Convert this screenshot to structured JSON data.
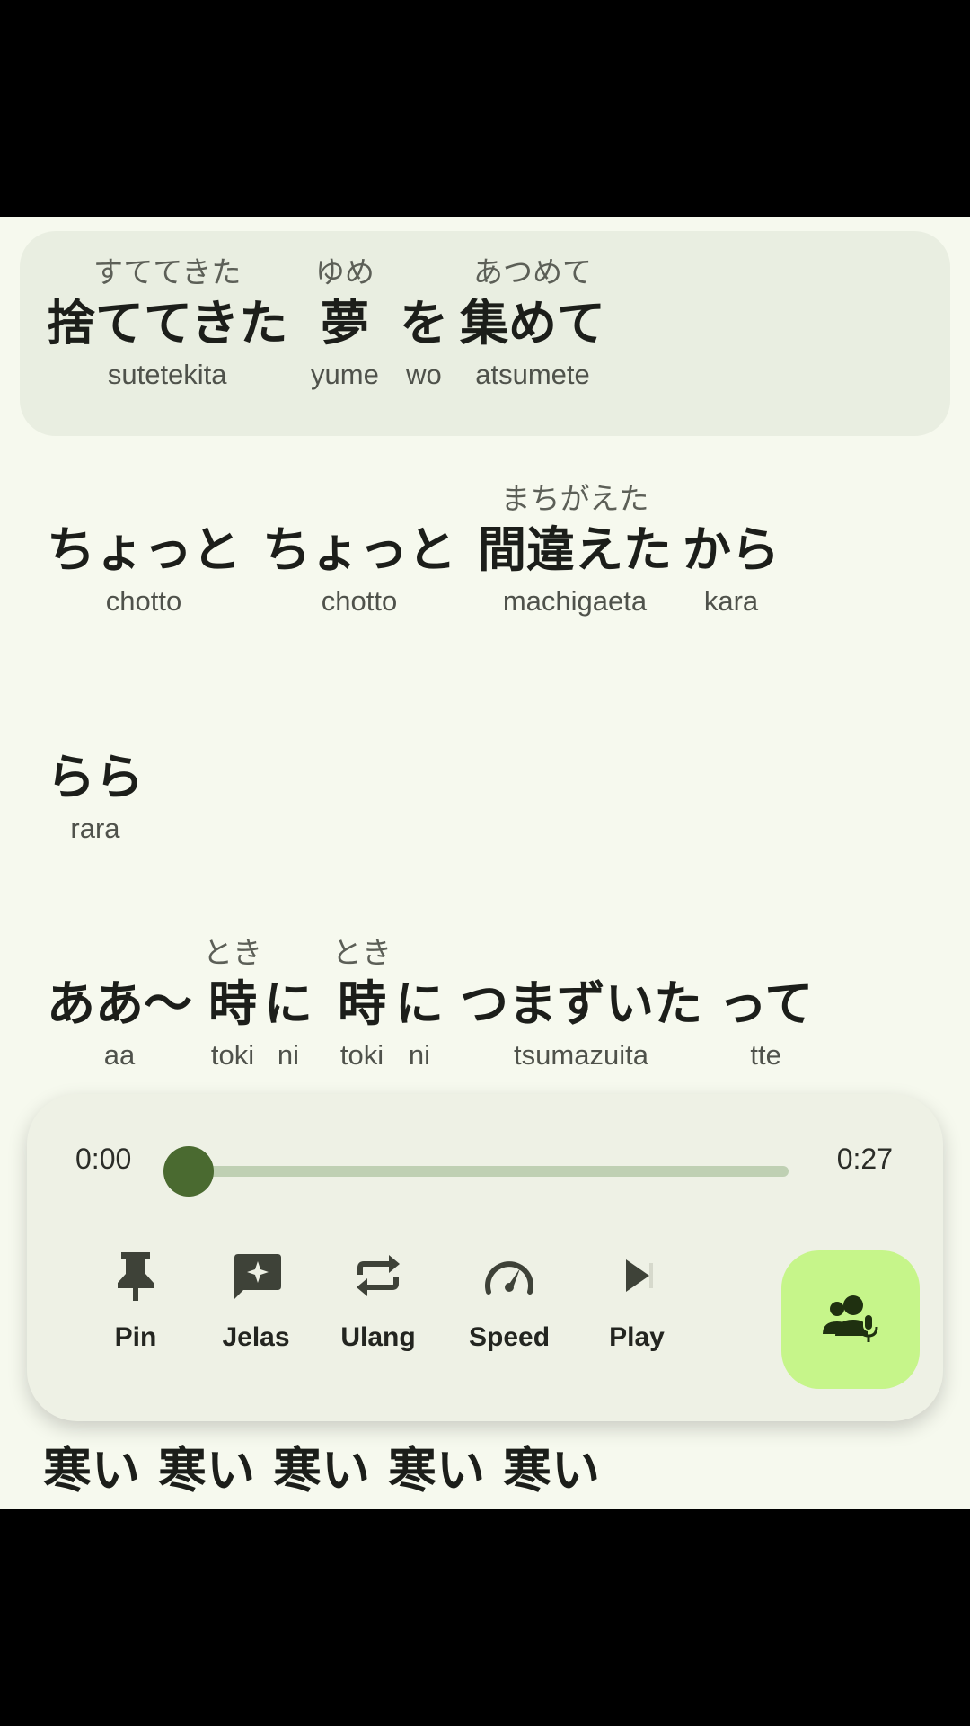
{
  "lyrics": [
    {
      "segments": [
        {
          "main": "捨ててきた",
          "ruby": "すててきた",
          "romaji": "sutetekita"
        },
        {
          "main": "夢",
          "ruby": "ゆめ",
          "romaji": "yume"
        },
        {
          "main": "を",
          "ruby": "",
          "romaji": "wo"
        },
        {
          "main": "集めて",
          "ruby": "あつめて",
          "romaji": "atsumete"
        }
      ]
    },
    {
      "segments": [
        {
          "main": "ちょっと",
          "ruby": "",
          "romaji": "chotto"
        },
        {
          "main": "ちょっと",
          "ruby": "",
          "romaji": "chotto"
        },
        {
          "main": "間違えた",
          "ruby": "まちがえた",
          "romaji": "machigaeta"
        },
        {
          "main": "から",
          "ruby": "",
          "romaji": "kara"
        }
      ]
    },
    {
      "segments": [
        {
          "main": "らら",
          "ruby": "",
          "romaji": "rara"
        }
      ]
    },
    {
      "segments": [
        {
          "main": "ああ〜",
          "ruby": "",
          "romaji": "aa"
        },
        {
          "main": "時",
          "ruby": "とき",
          "romaji": "toki"
        },
        {
          "main": "に",
          "ruby": "",
          "romaji": "ni"
        },
        {
          "main": "時",
          "ruby": "とき",
          "romaji": "toki"
        },
        {
          "main": "に",
          "ruby": "",
          "romaji": "ni"
        },
        {
          "main": "つまずいた",
          "ruby": "",
          "romaji": "tsumazuita"
        },
        {
          "main": "って",
          "ruby": "",
          "romaji": "tte"
        }
      ]
    },
    {
      "segments": [
        {
          "main": "寒い",
          "ruby": "",
          "romaji": ""
        },
        {
          "main": "寒い",
          "ruby": "",
          "romaji": ""
        },
        {
          "main": "寒い",
          "ruby": "",
          "romaji": ""
        },
        {
          "main": "寒い",
          "ruby": "",
          "romaji": ""
        },
        {
          "main": "寒い",
          "ruby": "",
          "romaji": ""
        }
      ]
    }
  ],
  "player": {
    "current_time": "0:00",
    "total_time": "0:27",
    "progress": 0,
    "controls": [
      {
        "label": "Pin",
        "icon": "pin-icon"
      },
      {
        "label": "Jelas",
        "icon": "explain-chat-icon"
      },
      {
        "label": "Ulang",
        "icon": "repeat-icon"
      },
      {
        "label": "Speed",
        "icon": "speedometer-icon"
      },
      {
        "label": "Play",
        "icon": "play-icon"
      }
    ],
    "voice_button_icon": "group-mic-icon",
    "colors": {
      "accent": "#4a6a30",
      "track": "#bfd0b3",
      "voice_button": "#c6f58a"
    }
  }
}
